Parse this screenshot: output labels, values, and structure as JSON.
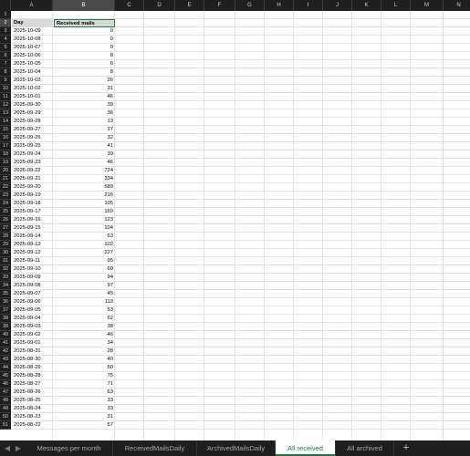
{
  "sheet": {
    "columns": [
      "A",
      "B",
      "C",
      "D",
      "E",
      "F",
      "G",
      "H",
      "I",
      "J",
      "K",
      "L",
      "M",
      "N"
    ],
    "rows": [
      "1",
      "2",
      "3",
      "4",
      "5",
      "6",
      "7",
      "8",
      "9",
      "10",
      "11",
      "12",
      "13",
      "14",
      "15",
      "16",
      "17",
      "18",
      "19",
      "20",
      "21",
      "22",
      "23",
      "24",
      "25",
      "26",
      "27",
      "28",
      "29",
      "30",
      "31",
      "32",
      "33",
      "34",
      "35",
      "36",
      "37",
      "38",
      "39",
      "40",
      "41",
      "42",
      "43",
      "44",
      "45",
      "46",
      "47",
      "48",
      "49",
      "50",
      "51"
    ],
    "header": {
      "day": "Day",
      "received": "Received mails"
    },
    "data": [
      [
        "2025-10-09",
        "0"
      ],
      [
        "2025-10-08",
        "0"
      ],
      [
        "2025-10-07",
        "0"
      ],
      [
        "2025-10-06",
        "8"
      ],
      [
        "2025-10-05",
        "6"
      ],
      [
        "2025-10-04",
        "8"
      ],
      [
        "2025-10-03",
        "26"
      ],
      [
        "2025-10-02",
        "31"
      ],
      [
        "2025-10-01",
        "46"
      ],
      [
        "2025-09-30",
        "39"
      ],
      [
        "2025-09-29",
        "36"
      ],
      [
        "2025-09-28",
        "13"
      ],
      [
        "2025-09-27",
        "27"
      ],
      [
        "2025-09-26",
        "32"
      ],
      [
        "2025-09-25",
        "41"
      ],
      [
        "2025-09-24",
        "39"
      ],
      [
        "2025-09-23",
        "46"
      ],
      [
        "2025-09-22",
        "724"
      ],
      [
        "2025-09-21",
        "334"
      ],
      [
        "2025-09-20",
        "589"
      ],
      [
        "2025-09-19",
        "216"
      ],
      [
        "2025-09-18",
        "105"
      ],
      [
        "2025-09-17",
        "169"
      ],
      [
        "2025-09-16",
        "123"
      ],
      [
        "2025-09-15",
        "104"
      ],
      [
        "2025-09-14",
        "63"
      ],
      [
        "2025-09-13",
        "102"
      ],
      [
        "2025-09-12",
        "227"
      ],
      [
        "2025-09-11",
        "95"
      ],
      [
        "2025-09-10",
        "60"
      ],
      [
        "2025-09-09",
        "94"
      ],
      [
        "2025-09-08",
        "97"
      ],
      [
        "2025-09-07",
        "45"
      ],
      [
        "2025-09-06",
        "113"
      ],
      [
        "2025-09-05",
        "53"
      ],
      [
        "2025-09-04",
        "52"
      ],
      [
        "2025-09-03",
        "38"
      ],
      [
        "2025-09-02",
        "46"
      ],
      [
        "2025-09-01",
        "34"
      ],
      [
        "2025-08-31",
        "28"
      ],
      [
        "2025-08-30",
        "40"
      ],
      [
        "2025-08-29",
        "50"
      ],
      [
        "2025-08-28",
        "75"
      ],
      [
        "2025-08-27",
        "71"
      ],
      [
        "2025-08-26",
        "63"
      ],
      [
        "2025-08-25",
        "33"
      ],
      [
        "2025-08-24",
        "33"
      ],
      [
        "2025-08-23",
        "31"
      ],
      [
        "2025-08-22",
        "57"
      ]
    ],
    "selected_cell": "B2"
  },
  "tabs": {
    "prev_glyph": "◀",
    "next_glyph": "▶",
    "items": [
      {
        "label": "Messages per month",
        "active": false
      },
      {
        "label": "ReceivedMailsDaily",
        "active": false
      },
      {
        "label": "ArchivedMailsDaily",
        "active": false
      },
      {
        "label": "All received",
        "active": true
      },
      {
        "label": "All archived",
        "active": false
      }
    ],
    "add_glyph": "+"
  },
  "colors": {
    "accent": "#1f7a3f",
    "header_fill": "#d9d9d9"
  }
}
